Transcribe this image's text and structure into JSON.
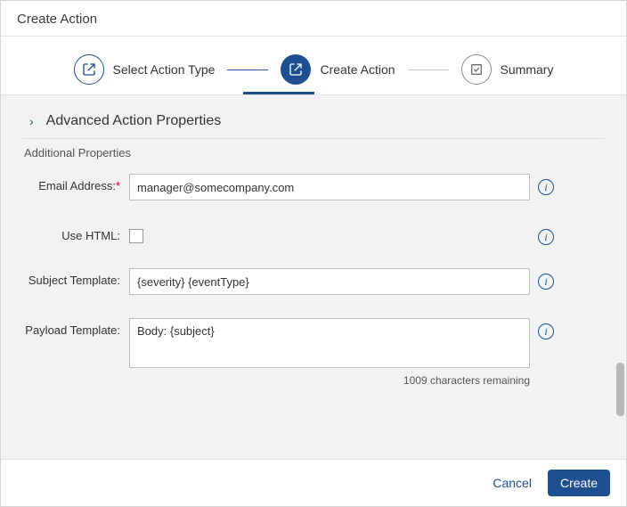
{
  "header": {
    "title": "Create Action"
  },
  "stepper": {
    "step1": "Select Action Type",
    "step2": "Create Action",
    "step3": "Summary"
  },
  "section": {
    "title": "Advanced Action Properties",
    "subtitle": "Additional Properties"
  },
  "form": {
    "email": {
      "label": "Email Address:",
      "value": "manager@somecompany.com"
    },
    "useHtml": {
      "label": "Use HTML:"
    },
    "subject": {
      "label": "Subject Template:",
      "value": "{severity} {eventType}"
    },
    "payload": {
      "label": "Payload Template:",
      "value": "Body: {subject}",
      "counter": "1009 characters remaining"
    }
  },
  "footer": {
    "cancel": "Cancel",
    "create": "Create"
  },
  "icons": {
    "info": "i"
  }
}
